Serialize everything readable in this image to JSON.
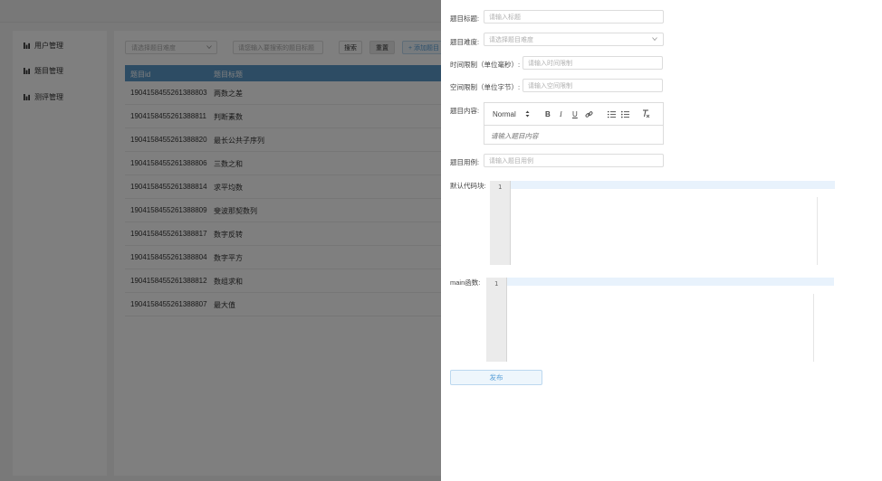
{
  "sidebar": {
    "items": [
      {
        "label": "用户管理",
        "icon": "chart-icon"
      },
      {
        "label": "题目管理",
        "icon": "chart-icon"
      },
      {
        "label": "测评管理",
        "icon": "chart-icon"
      }
    ]
  },
  "toolbar": {
    "difficulty_placeholder": "请选择题目难度",
    "search_placeholder": "请您输入要搜索的题目标题",
    "search_label": "搜索",
    "reset_label": "重置",
    "add_label": "+ 添加题目"
  },
  "table": {
    "headers": [
      "题目id",
      "题目标题"
    ],
    "rows": [
      {
        "id": "1904158455261388803",
        "title": "两数之差"
      },
      {
        "id": "1904158455261388811",
        "title": "判断素数"
      },
      {
        "id": "1904158455261388820",
        "title": "最长公共子序列"
      },
      {
        "id": "1904158455261388806",
        "title": "三数之和"
      },
      {
        "id": "1904158455261388814",
        "title": "求平均数"
      },
      {
        "id": "1904158455261388809",
        "title": "斐波那契数列"
      },
      {
        "id": "1904158455261388817",
        "title": "数字反转"
      },
      {
        "id": "1904158455261388804",
        "title": "数字平方"
      },
      {
        "id": "1904158455261388812",
        "title": "数组求和"
      },
      {
        "id": "1904158455261388807",
        "title": "最大值"
      }
    ]
  },
  "form": {
    "title_label": "题目标题:",
    "title_placeholder": "请输入标题",
    "difficulty_label": "题目难度:",
    "difficulty_placeholder": "请选择题目难度",
    "time_label": "时间限制（单位毫秒）:",
    "time_placeholder": "请输入时间限制",
    "space_label": "空间限制（单位字节）:",
    "space_placeholder": "请输入空间限制",
    "content_label": "题目内容:",
    "editor_format": "Normal",
    "editor_bold": "B",
    "editor_italic": "I",
    "editor_underline": "U",
    "editor_placeholder": "请输入题目内容",
    "example_label": "题目用例:",
    "example_placeholder": "请输入题目用例",
    "default_code_label": "默认代码块:",
    "main_label": "main函数:",
    "line_number": "1",
    "publish_label": "发布"
  }
}
